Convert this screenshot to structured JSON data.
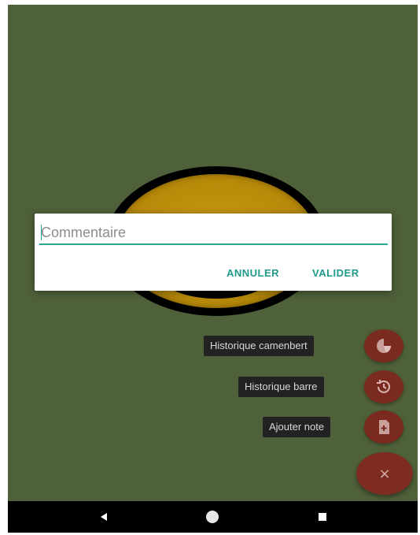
{
  "dialog": {
    "input_placeholder": "Commentaire",
    "input_value": "",
    "cancel_label": "ANNULER",
    "ok_label": "VALIDER"
  },
  "fab_menu": {
    "items": [
      {
        "label": "Historique camenbert",
        "icon": "pie-chart-icon"
      },
      {
        "label": "Historique barre",
        "icon": "history-icon"
      },
      {
        "label": "Ajouter note",
        "icon": "add-note-icon"
      }
    ],
    "close_label": "×"
  },
  "navbar": {
    "back_icon": "back-triangle-icon",
    "home_icon": "home-circle-icon",
    "recents_icon": "recents-square-icon"
  },
  "colors": {
    "background": "#4f613a",
    "accent": "#2aa596",
    "fab": "#7e2c22",
    "target_gold": "#b98b0a"
  }
}
